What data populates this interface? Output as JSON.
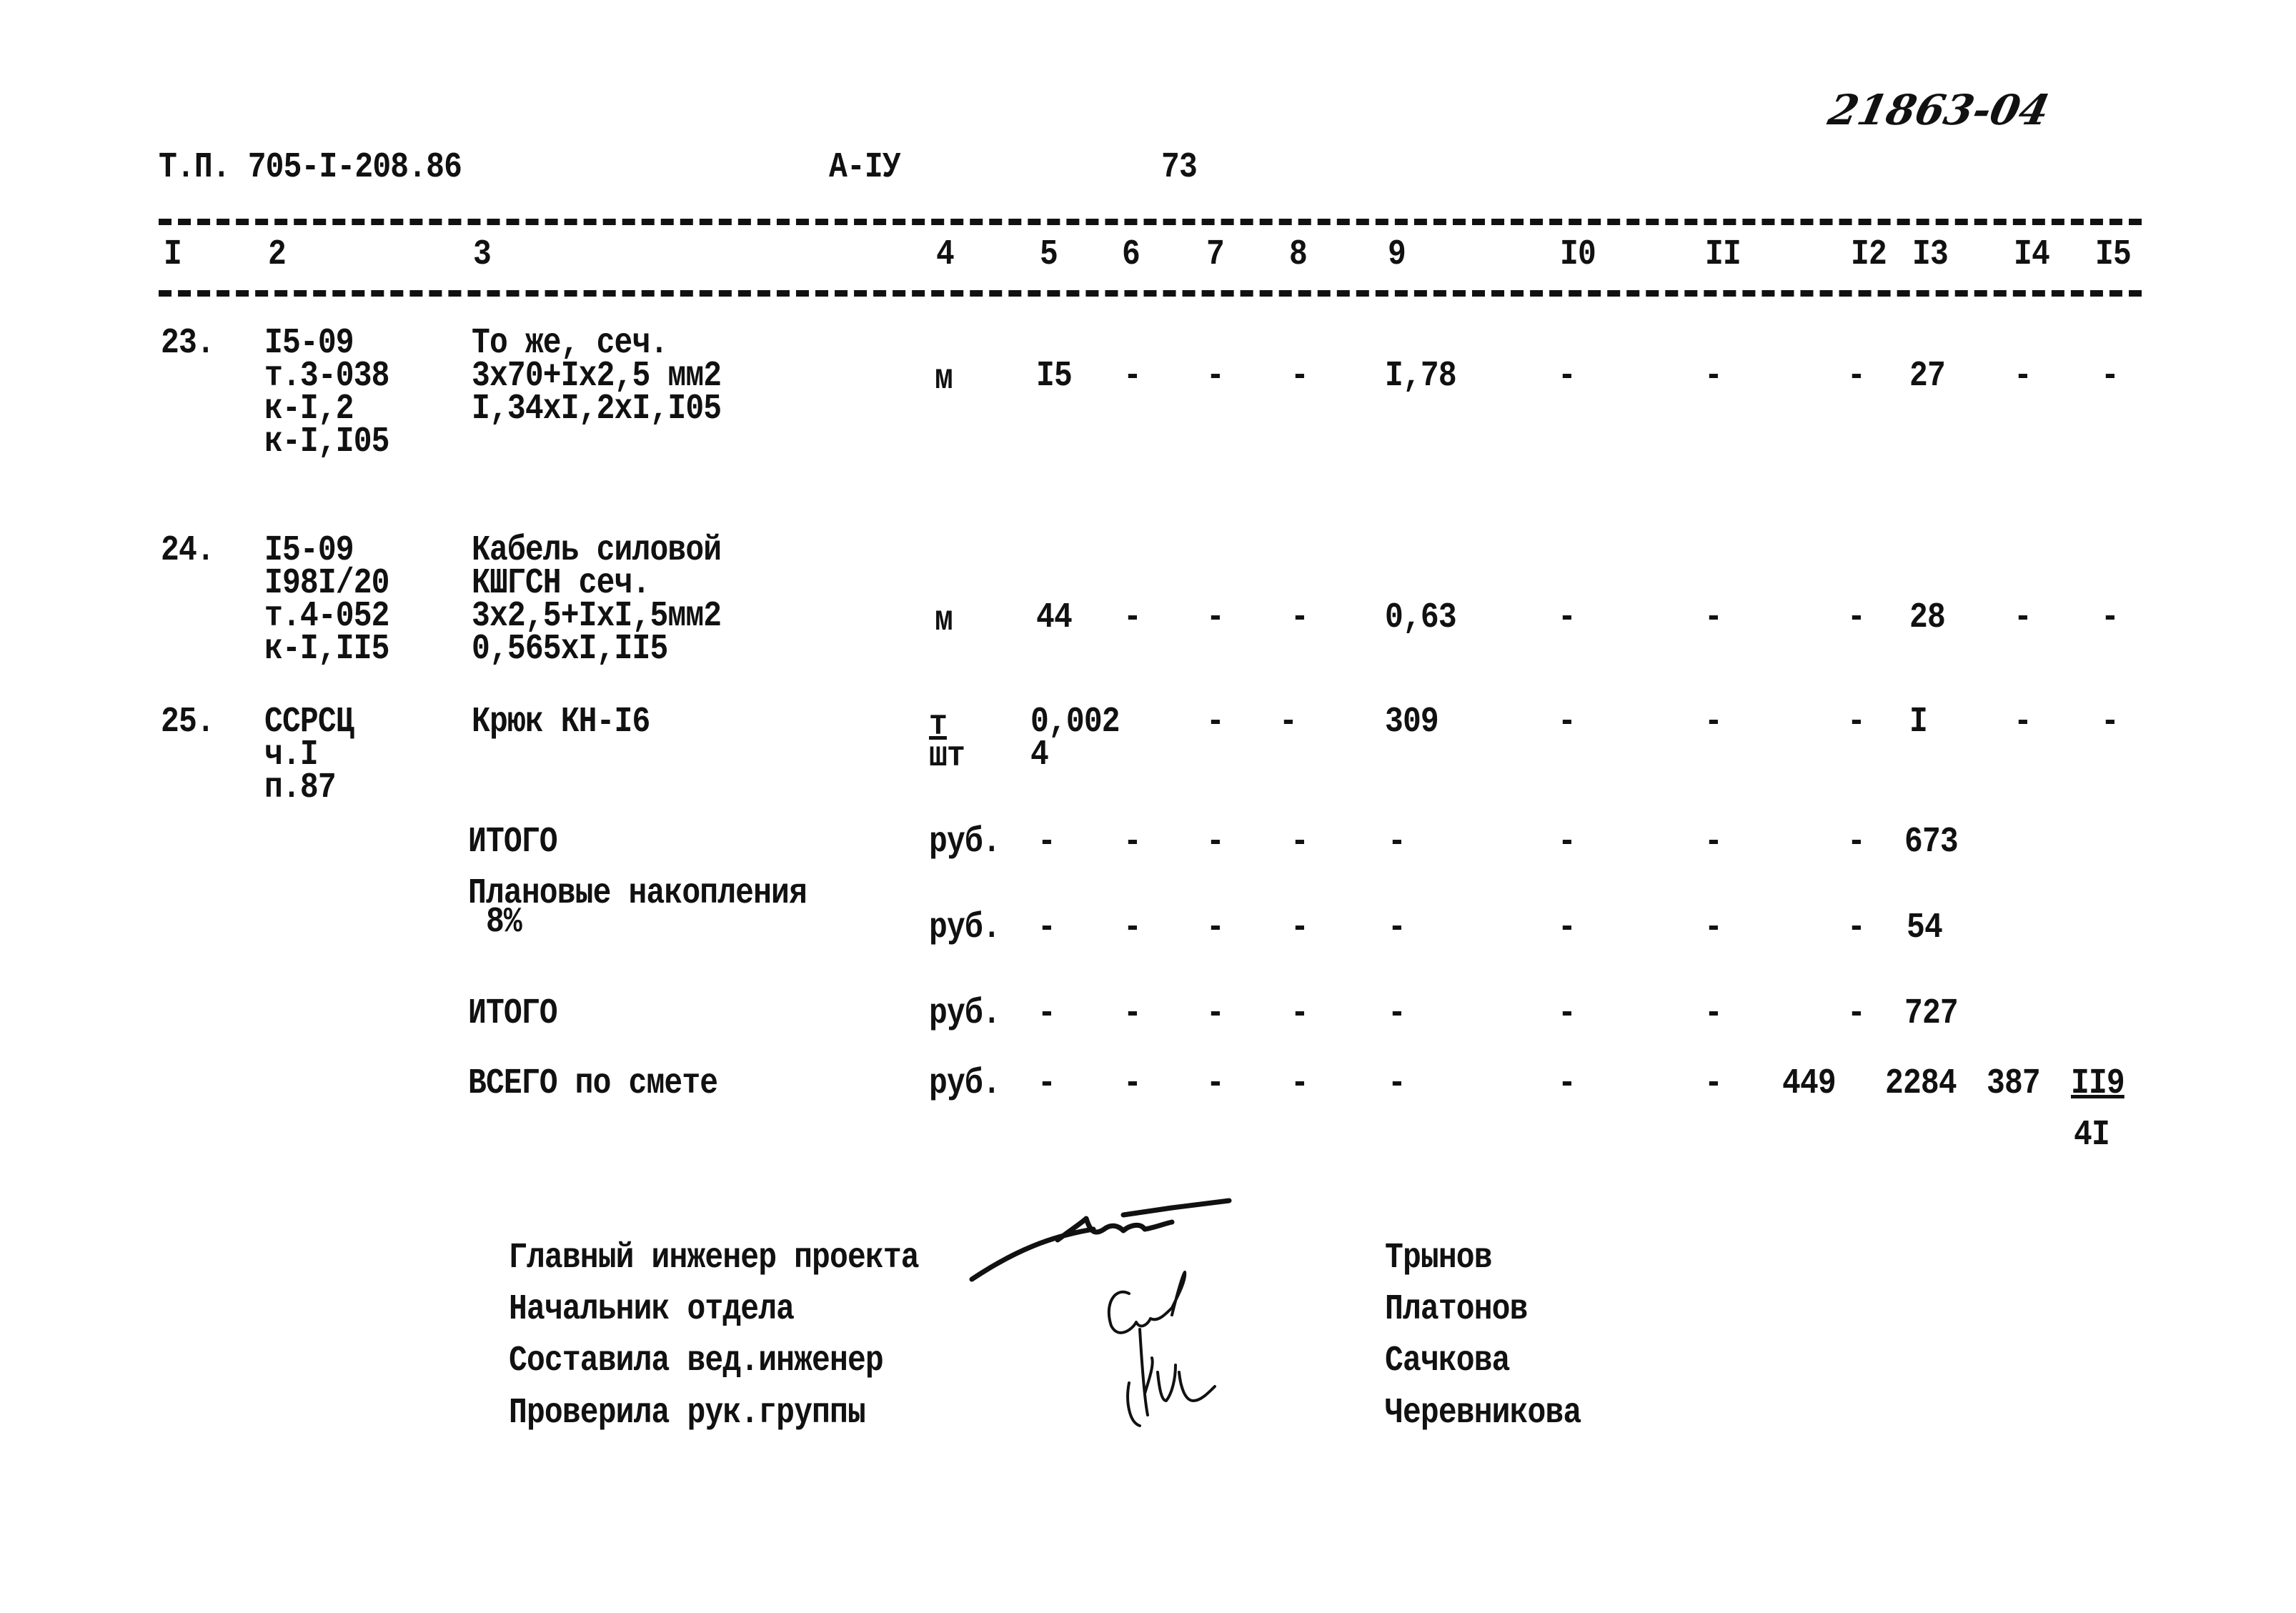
{
  "document": {
    "handwritten_number": "21863-04",
    "header": {
      "project_code": "Т.П. 705-I-208.86",
      "album": "А-IУ",
      "page_number": "73"
    },
    "column_headers": [
      "I",
      "2",
      "3",
      "4",
      "5",
      "6",
      "7",
      "8",
      "9",
      "I0",
      "II",
      "I2",
      "I3",
      "I4",
      "I5"
    ],
    "rows": [
      {
        "num": "23.",
        "code_lines": [
          "I5-09",
          "т.3-038",
          "к-I,2",
          "к-I,I05"
        ],
        "desc_lines": [
          "То же, сеч.",
          "3х70+Iх2,5 мм2",
          "I,34хI,2хI,I05"
        ],
        "unit": "м",
        "c5": "I5",
        "c6": "-",
        "c7": "-",
        "c8": "-",
        "c9": "I,78",
        "c10": "-",
        "c11": "-",
        "c12": "-",
        "c13": "27",
        "c14": "-",
        "c15": "-"
      },
      {
        "num": "24.",
        "code_lines": [
          "I5-09",
          "I98I/20",
          "т.4-052",
          "к-I,II5"
        ],
        "desc_lines": [
          "Кабель силовой",
          "КШГСН сеч.",
          "3х2,5+IхI,5мм2",
          "0,565хI,II5"
        ],
        "unit": "м",
        "c5": "44",
        "c6": "-",
        "c7": "-",
        "c8": "-",
        "c9": "0,63",
        "c10": "-",
        "c11": "-",
        "c12": "-",
        "c13": "28",
        "c14": "-",
        "c15": "-"
      },
      {
        "num": "25.",
        "code_lines": [
          "ССРСЦ",
          "ч.I",
          "п.87"
        ],
        "desc_lines": [
          "Крюк КН-I6"
        ],
        "unit_lines": [
          "т",
          "шт"
        ],
        "c5_lines": [
          "0,002",
          "4"
        ],
        "c7": "-",
        "c8": "-",
        "c9": "309",
        "c10": "-",
        "c11": "-",
        "c12": "-",
        "c13": "I",
        "c14": "-",
        "c15": "-"
      }
    ],
    "totals": [
      {
        "label": "ИТОГО",
        "unit": "руб.",
        "dashes": [
          "-",
          "-",
          "-",
          "-",
          "-",
          "-",
          "-",
          "-"
        ],
        "c13": "673"
      },
      {
        "label_lines": [
          "Плановые накопления",
          " 8%"
        ],
        "unit": "руб.",
        "dashes": [
          "-",
          "-",
          "-",
          "-",
          "-",
          "-",
          "-",
          "-"
        ],
        "c13": "54"
      },
      {
        "label": "ИТОГО",
        "unit": "руб.",
        "dashes": [
          "-",
          "-",
          "-",
          "-",
          "-",
          "-",
          "-",
          "-"
        ],
        "c13": "727"
      },
      {
        "label": "ВСЕГО по смете",
        "unit": "руб.",
        "dashes": [
          "-",
          "-",
          "-",
          "-",
          "-",
          "-",
          "-"
        ],
        "c12": "449",
        "c13": "2284",
        "c14": "387",
        "c15": "II9",
        "c15_second": "4I"
      }
    ],
    "signatures": [
      {
        "role": "Главный инженер проекта",
        "name": "Трынов"
      },
      {
        "role": "Начальник отдела",
        "name": "Платонов"
      },
      {
        "role": "Составила вед.инженер",
        "name": "Сачкова"
      },
      {
        "role": "Проверила рук.группы",
        "name": "Черевникова"
      }
    ]
  }
}
